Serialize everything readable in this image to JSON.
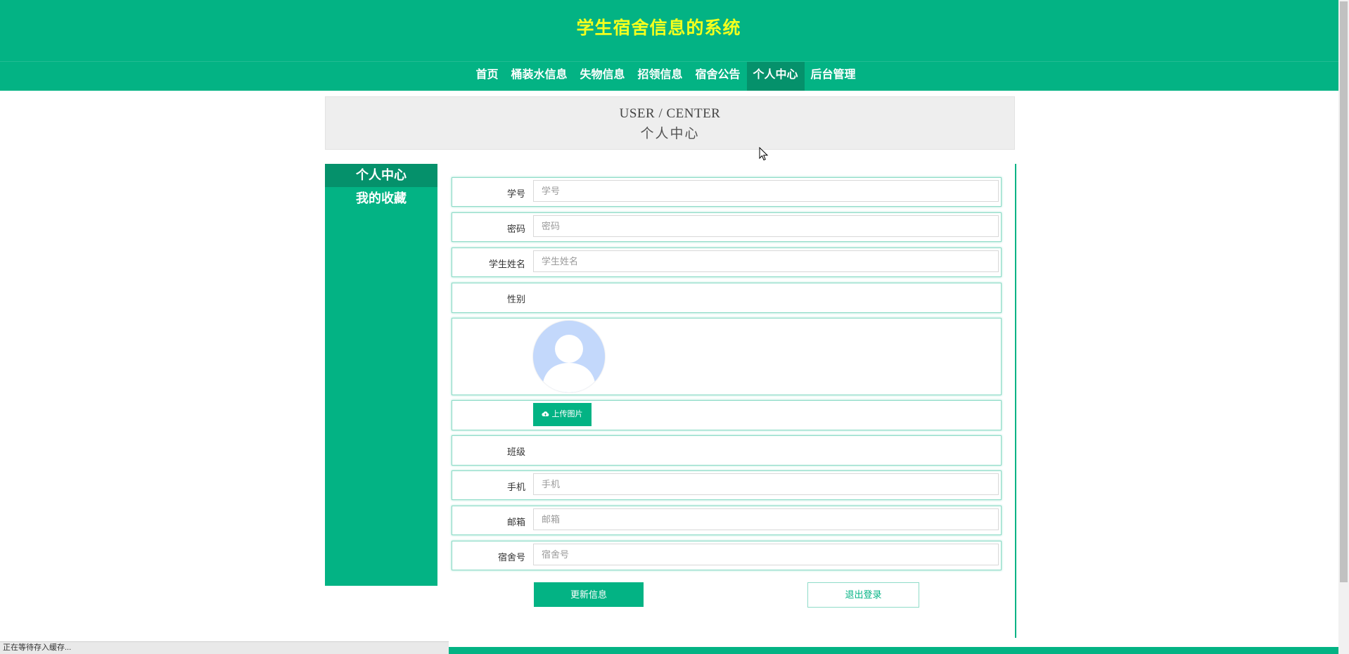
{
  "header": {
    "site_title": "学生宿舍信息的系统",
    "nav": [
      {
        "label": "首页",
        "active": false
      },
      {
        "label": "桶装水信息",
        "active": false
      },
      {
        "label": "失物信息",
        "active": false
      },
      {
        "label": "招领信息",
        "active": false
      },
      {
        "label": "宿舍公告",
        "active": false
      },
      {
        "label": "个人中心",
        "active": true
      },
      {
        "label": "后台管理",
        "active": false
      }
    ]
  },
  "banner": {
    "en": "USER / CENTER",
    "cn": "个人中心"
  },
  "sidebar": {
    "items": [
      {
        "label": "个人中心",
        "active": true
      },
      {
        "label": "我的收藏",
        "active": false
      }
    ]
  },
  "form": {
    "student_id": {
      "label": "学号",
      "value": "",
      "placeholder": "学号"
    },
    "password": {
      "label": "密码",
      "value": "",
      "placeholder": "密码"
    },
    "student_name": {
      "label": "学生姓名",
      "value": "",
      "placeholder": "学生姓名"
    },
    "gender": {
      "label": "性别",
      "value": ""
    },
    "upload": {
      "label": "上传图片",
      "icon": "cloud-upload-icon"
    },
    "class": {
      "label": "班级",
      "value": ""
    },
    "phone": {
      "label": "手机",
      "value": "",
      "placeholder": "手机"
    },
    "email": {
      "label": "邮箱",
      "value": "",
      "placeholder": "邮箱"
    },
    "dorm": {
      "label": "宿舍号",
      "value": "",
      "placeholder": "宿舍号"
    }
  },
  "buttons": {
    "update": "更新信息",
    "logout": "退出登录"
  },
  "status_bar": {
    "text": "正在等待存入缓存..."
  },
  "colors": {
    "primary": "#03b384",
    "primary_dark": "#05916b",
    "title_yellow": "#f4ff1d"
  }
}
